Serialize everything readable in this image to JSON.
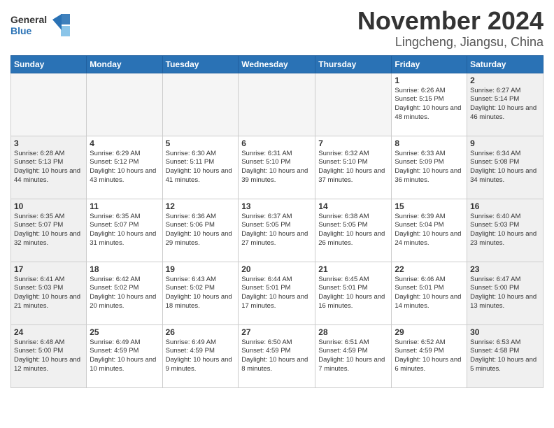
{
  "header": {
    "logo_general": "General",
    "logo_blue": "Blue",
    "title": "November 2024",
    "subtitle": "Lingcheng, Jiangsu, China"
  },
  "calendar": {
    "weekdays": [
      "Sunday",
      "Monday",
      "Tuesday",
      "Wednesday",
      "Thursday",
      "Friday",
      "Saturday"
    ],
    "weeks": [
      [
        {
          "day": "",
          "info": ""
        },
        {
          "day": "",
          "info": ""
        },
        {
          "day": "",
          "info": ""
        },
        {
          "day": "",
          "info": ""
        },
        {
          "day": "",
          "info": ""
        },
        {
          "day": "1",
          "info": "Sunrise: 6:26 AM\nSunset: 5:15 PM\nDaylight: 10 hours and 48 minutes."
        },
        {
          "day": "2",
          "info": "Sunrise: 6:27 AM\nSunset: 5:14 PM\nDaylight: 10 hours and 46 minutes."
        }
      ],
      [
        {
          "day": "3",
          "info": "Sunrise: 6:28 AM\nSunset: 5:13 PM\nDaylight: 10 hours and 44 minutes."
        },
        {
          "day": "4",
          "info": "Sunrise: 6:29 AM\nSunset: 5:12 PM\nDaylight: 10 hours and 43 minutes."
        },
        {
          "day": "5",
          "info": "Sunrise: 6:30 AM\nSunset: 5:11 PM\nDaylight: 10 hours and 41 minutes."
        },
        {
          "day": "6",
          "info": "Sunrise: 6:31 AM\nSunset: 5:10 PM\nDaylight: 10 hours and 39 minutes."
        },
        {
          "day": "7",
          "info": "Sunrise: 6:32 AM\nSunset: 5:10 PM\nDaylight: 10 hours and 37 minutes."
        },
        {
          "day": "8",
          "info": "Sunrise: 6:33 AM\nSunset: 5:09 PM\nDaylight: 10 hours and 36 minutes."
        },
        {
          "day": "9",
          "info": "Sunrise: 6:34 AM\nSunset: 5:08 PM\nDaylight: 10 hours and 34 minutes."
        }
      ],
      [
        {
          "day": "10",
          "info": "Sunrise: 6:35 AM\nSunset: 5:07 PM\nDaylight: 10 hours and 32 minutes."
        },
        {
          "day": "11",
          "info": "Sunrise: 6:35 AM\nSunset: 5:07 PM\nDaylight: 10 hours and 31 minutes."
        },
        {
          "day": "12",
          "info": "Sunrise: 6:36 AM\nSunset: 5:06 PM\nDaylight: 10 hours and 29 minutes."
        },
        {
          "day": "13",
          "info": "Sunrise: 6:37 AM\nSunset: 5:05 PM\nDaylight: 10 hours and 27 minutes."
        },
        {
          "day": "14",
          "info": "Sunrise: 6:38 AM\nSunset: 5:05 PM\nDaylight: 10 hours and 26 minutes."
        },
        {
          "day": "15",
          "info": "Sunrise: 6:39 AM\nSunset: 5:04 PM\nDaylight: 10 hours and 24 minutes."
        },
        {
          "day": "16",
          "info": "Sunrise: 6:40 AM\nSunset: 5:03 PM\nDaylight: 10 hours and 23 minutes."
        }
      ],
      [
        {
          "day": "17",
          "info": "Sunrise: 6:41 AM\nSunset: 5:03 PM\nDaylight: 10 hours and 21 minutes."
        },
        {
          "day": "18",
          "info": "Sunrise: 6:42 AM\nSunset: 5:02 PM\nDaylight: 10 hours and 20 minutes."
        },
        {
          "day": "19",
          "info": "Sunrise: 6:43 AM\nSunset: 5:02 PM\nDaylight: 10 hours and 18 minutes."
        },
        {
          "day": "20",
          "info": "Sunrise: 6:44 AM\nSunset: 5:01 PM\nDaylight: 10 hours and 17 minutes."
        },
        {
          "day": "21",
          "info": "Sunrise: 6:45 AM\nSunset: 5:01 PM\nDaylight: 10 hours and 16 minutes."
        },
        {
          "day": "22",
          "info": "Sunrise: 6:46 AM\nSunset: 5:01 PM\nDaylight: 10 hours and 14 minutes."
        },
        {
          "day": "23",
          "info": "Sunrise: 6:47 AM\nSunset: 5:00 PM\nDaylight: 10 hours and 13 minutes."
        }
      ],
      [
        {
          "day": "24",
          "info": "Sunrise: 6:48 AM\nSunset: 5:00 PM\nDaylight: 10 hours and 12 minutes."
        },
        {
          "day": "25",
          "info": "Sunrise: 6:49 AM\nSunset: 4:59 PM\nDaylight: 10 hours and 10 minutes."
        },
        {
          "day": "26",
          "info": "Sunrise: 6:49 AM\nSunset: 4:59 PM\nDaylight: 10 hours and 9 minutes."
        },
        {
          "day": "27",
          "info": "Sunrise: 6:50 AM\nSunset: 4:59 PM\nDaylight: 10 hours and 8 minutes."
        },
        {
          "day": "28",
          "info": "Sunrise: 6:51 AM\nSunset: 4:59 PM\nDaylight: 10 hours and 7 minutes."
        },
        {
          "day": "29",
          "info": "Sunrise: 6:52 AM\nSunset: 4:59 PM\nDaylight: 10 hours and 6 minutes."
        },
        {
          "day": "30",
          "info": "Sunrise: 6:53 AM\nSunset: 4:58 PM\nDaylight: 10 hours and 5 minutes."
        }
      ]
    ]
  }
}
